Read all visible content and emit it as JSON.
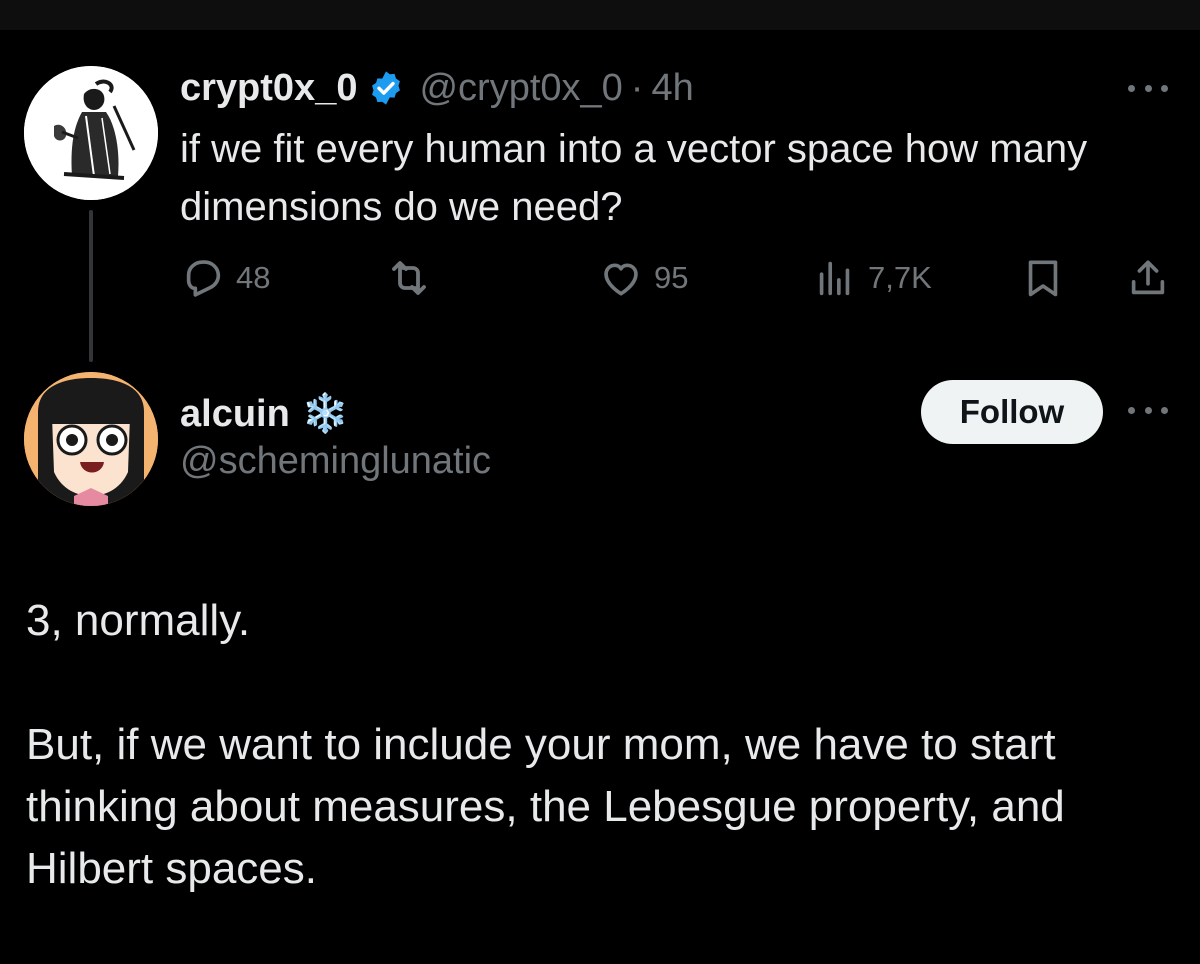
{
  "colors": {
    "background": "#000000",
    "primary_text": "#e7e9ea",
    "secondary_text": "#71767b",
    "verified_blue": "#1d9bf0",
    "follow_button_bg": "#eff3f4",
    "follow_button_text": "#0f1419"
  },
  "parent_tweet": {
    "display_name": "crypt0x_0",
    "verified_icon": "verified-badge-icon",
    "handle": "@crypt0x_0",
    "separator": "·",
    "time": "4h",
    "text": "if we fit every human into a vector space how many dimensions do we need?",
    "actions": {
      "reply": {
        "icon": "reply-icon",
        "count": "48"
      },
      "retweet": {
        "icon": "retweet-icon",
        "count": ""
      },
      "like": {
        "icon": "heart-icon",
        "count": "95"
      },
      "views": {
        "icon": "views-icon",
        "count": "7,7K"
      },
      "bookmark": {
        "icon": "bookmark-icon"
      },
      "share": {
        "icon": "share-icon"
      }
    }
  },
  "reply_tweet": {
    "display_name": "alcuin",
    "emoji": "❄️",
    "handle": "@scheminglunatic",
    "follow_label": "Follow",
    "paragraphs": [
      "3, normally.",
      "But, if we want to include your mom, we have to start thinking about measures, the Lebesgue property, and Hilbert spaces."
    ]
  }
}
